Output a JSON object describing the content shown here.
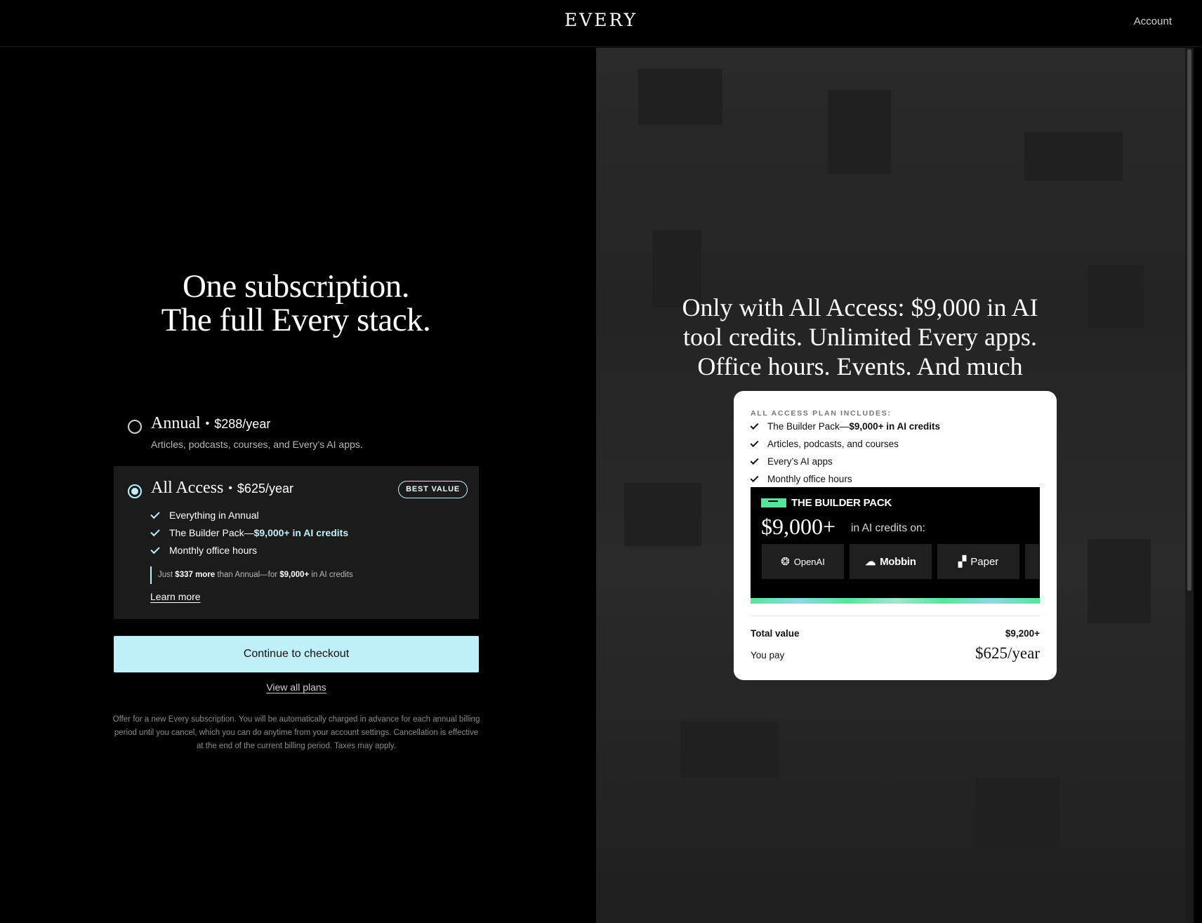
{
  "header": {
    "logo": "EVERY",
    "account": "Account"
  },
  "left": {
    "headline_line1": "One subscription.",
    "headline_line2": "The full Every stack.",
    "annual": {
      "name": "Annual",
      "price": "$288/year",
      "description": "Articles, podcasts, courses, and Every’s AI apps.",
      "selected": false
    },
    "all_access": {
      "name": "All Access",
      "price": "$625/year",
      "badge": "BEST VALUE",
      "selected": true,
      "features": [
        {
          "text": "Everything in Annual",
          "highlight": ""
        },
        {
          "text": "The Builder Pack—",
          "highlight": "$9,000+ in AI credits"
        },
        {
          "text": "Monthly office hours",
          "highlight": ""
        }
      ],
      "note_prefix": "Just ",
      "note_bold1": "$337 more",
      "note_mid": " than Annual—for ",
      "note_bold2": "$9,000+",
      "note_suffix": " in AI credits",
      "learn_more": "Learn more"
    },
    "checkout_button": "Continue to checkout",
    "view_all": "View all plans",
    "fine_print": "Offer for a new Every subscription. You will be automatically charged in advance for each annual billing period until you cancel, which you can do anytime from your account settings. Cancellation is effective at the end of the current billing period. Taxes may apply."
  },
  "right": {
    "headline": "Only with All Access: $9,000 in AI tool credits. Unlimited Every apps. Office hours. Events. And much more.",
    "card": {
      "label": "ALL ACCESS PLAN INCLUDES:",
      "items": [
        {
          "text": "The Builder Pack—",
          "bold": "$9,000+ in AI credits"
        },
        {
          "text": "Articles, podcasts, and courses",
          "bold": ""
        },
        {
          "text": "Every’s AI apps",
          "bold": ""
        },
        {
          "text": "Monthly office hours",
          "bold": ""
        }
      ],
      "pack_title": "THE BUILDER PACK",
      "pack_amount": "$9,000+",
      "pack_sub": "in AI credits on:",
      "partners": [
        "OpenAI",
        "Mobbin",
        "Paper"
      ],
      "total_label": "Total value",
      "total_value": "$9,200+",
      "pay_label": "You pay",
      "pay_value": "$625/year"
    }
  },
  "colors": {
    "accent": "#bfeff8",
    "pack_green": "#58e59b",
    "background": "#000000"
  }
}
